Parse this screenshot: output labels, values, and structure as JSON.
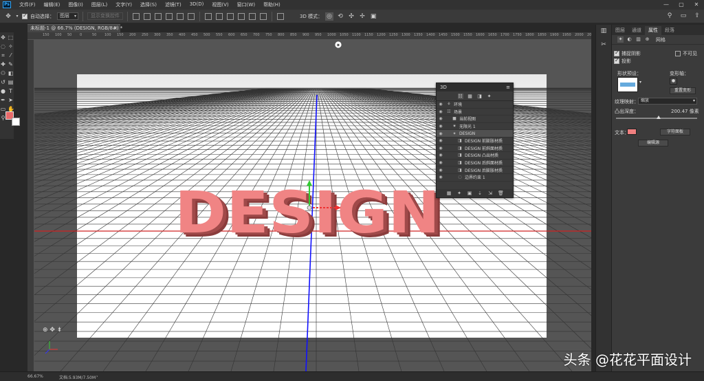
{
  "app": {
    "logo_text": "Ps"
  },
  "menu": [
    "文件(F)",
    "编辑(E)",
    "图像(I)",
    "图层(L)",
    "文字(Y)",
    "选择(S)",
    "滤镜(T)",
    "3D(D)",
    "视图(V)",
    "窗口(W)",
    "帮助(H)"
  ],
  "window_controls": {
    "minimize": "—",
    "maximize": "▢",
    "close": "✕"
  },
  "options": {
    "auto_select_label": "自动选择：",
    "auto_select_value": "图层",
    "show_transform_label": "显示变换控件",
    "mode3d_label": "3D 模式："
  },
  "document_tab": {
    "title": "未标题-1 @ 66.7% (DESIGN, RGB/8#) *",
    "close": "×"
  },
  "ruler_ticks": [
    "150",
    "100",
    "50",
    "0",
    "50",
    "100",
    "150",
    "200",
    "250",
    "300",
    "350",
    "400",
    "450",
    "500",
    "550",
    "600",
    "650",
    "700",
    "750",
    "800",
    "850",
    "900",
    "950",
    "1000",
    "1050",
    "1100",
    "1150",
    "1200",
    "1250",
    "1300",
    "1350",
    "1400",
    "1450",
    "1500",
    "1550",
    "1600",
    "1650",
    "1700",
    "1750",
    "1800",
    "1850",
    "1900",
    "1950",
    "2000",
    "2050"
  ],
  "canvas": {
    "text3d": "DESIGN",
    "text_color": "#f08484",
    "text_side_color": "#a04a4a"
  },
  "panel3d": {
    "title": "3D",
    "menu_icon": "≡",
    "rows": [
      {
        "label": "环境",
        "indent": 0,
        "icon": "⚘",
        "selected": false
      },
      {
        "label": "场景",
        "indent": 0,
        "icon": "☷",
        "selected": false
      },
      {
        "label": "当前视图",
        "indent": 1,
        "icon": "■",
        "selected": false
      },
      {
        "label": "无限光 1",
        "indent": 1,
        "icon": "✷",
        "selected": false
      },
      {
        "label": "DESIGN",
        "indent": 1,
        "icon": "✦",
        "selected": true
      },
      {
        "label": "DESIGN 前膨胀材质",
        "indent": 2,
        "icon": "◨",
        "selected": false
      },
      {
        "label": "DESIGN 前斜面材质",
        "indent": 2,
        "icon": "◨",
        "selected": false
      },
      {
        "label": "DESIGN 凸出材质",
        "indent": 2,
        "icon": "◨",
        "selected": false
      },
      {
        "label": "DESIGN 后斜面材质",
        "indent": 2,
        "icon": "◨",
        "selected": false
      },
      {
        "label": "DESIGN 后膨胀材质",
        "indent": 2,
        "icon": "◨",
        "selected": false
      },
      {
        "label": "边界约束 1",
        "indent": 2,
        "icon": "◌",
        "selected": false
      }
    ]
  },
  "properties": {
    "tabs": [
      "图层",
      "通道",
      "属性",
      "段落"
    ],
    "active_tab": 2,
    "mesh_label": "网格",
    "catch_shadow": "捕捉阴影",
    "invisible": "不可见",
    "cast_shadow": "投影",
    "shape_preset": "形状预设：",
    "deform_axis": "变形轴：",
    "reset_deform": "重置变形",
    "texture_map": "纹理映射：",
    "texture_value": "缩放",
    "extrusion_depth_label": "凸出深度：",
    "extrusion_depth_value": "200.47 像素",
    "extrusion_fraction": 0.5,
    "text_label": "文本：",
    "text_color": "#f08080",
    "char_panel": "字符面板",
    "edit_source": "编辑源"
  },
  "status": {
    "zoom": "66.67%",
    "doc": "文档:5.93M/7.50M"
  },
  "watermark": "头条 @花花平面设计"
}
